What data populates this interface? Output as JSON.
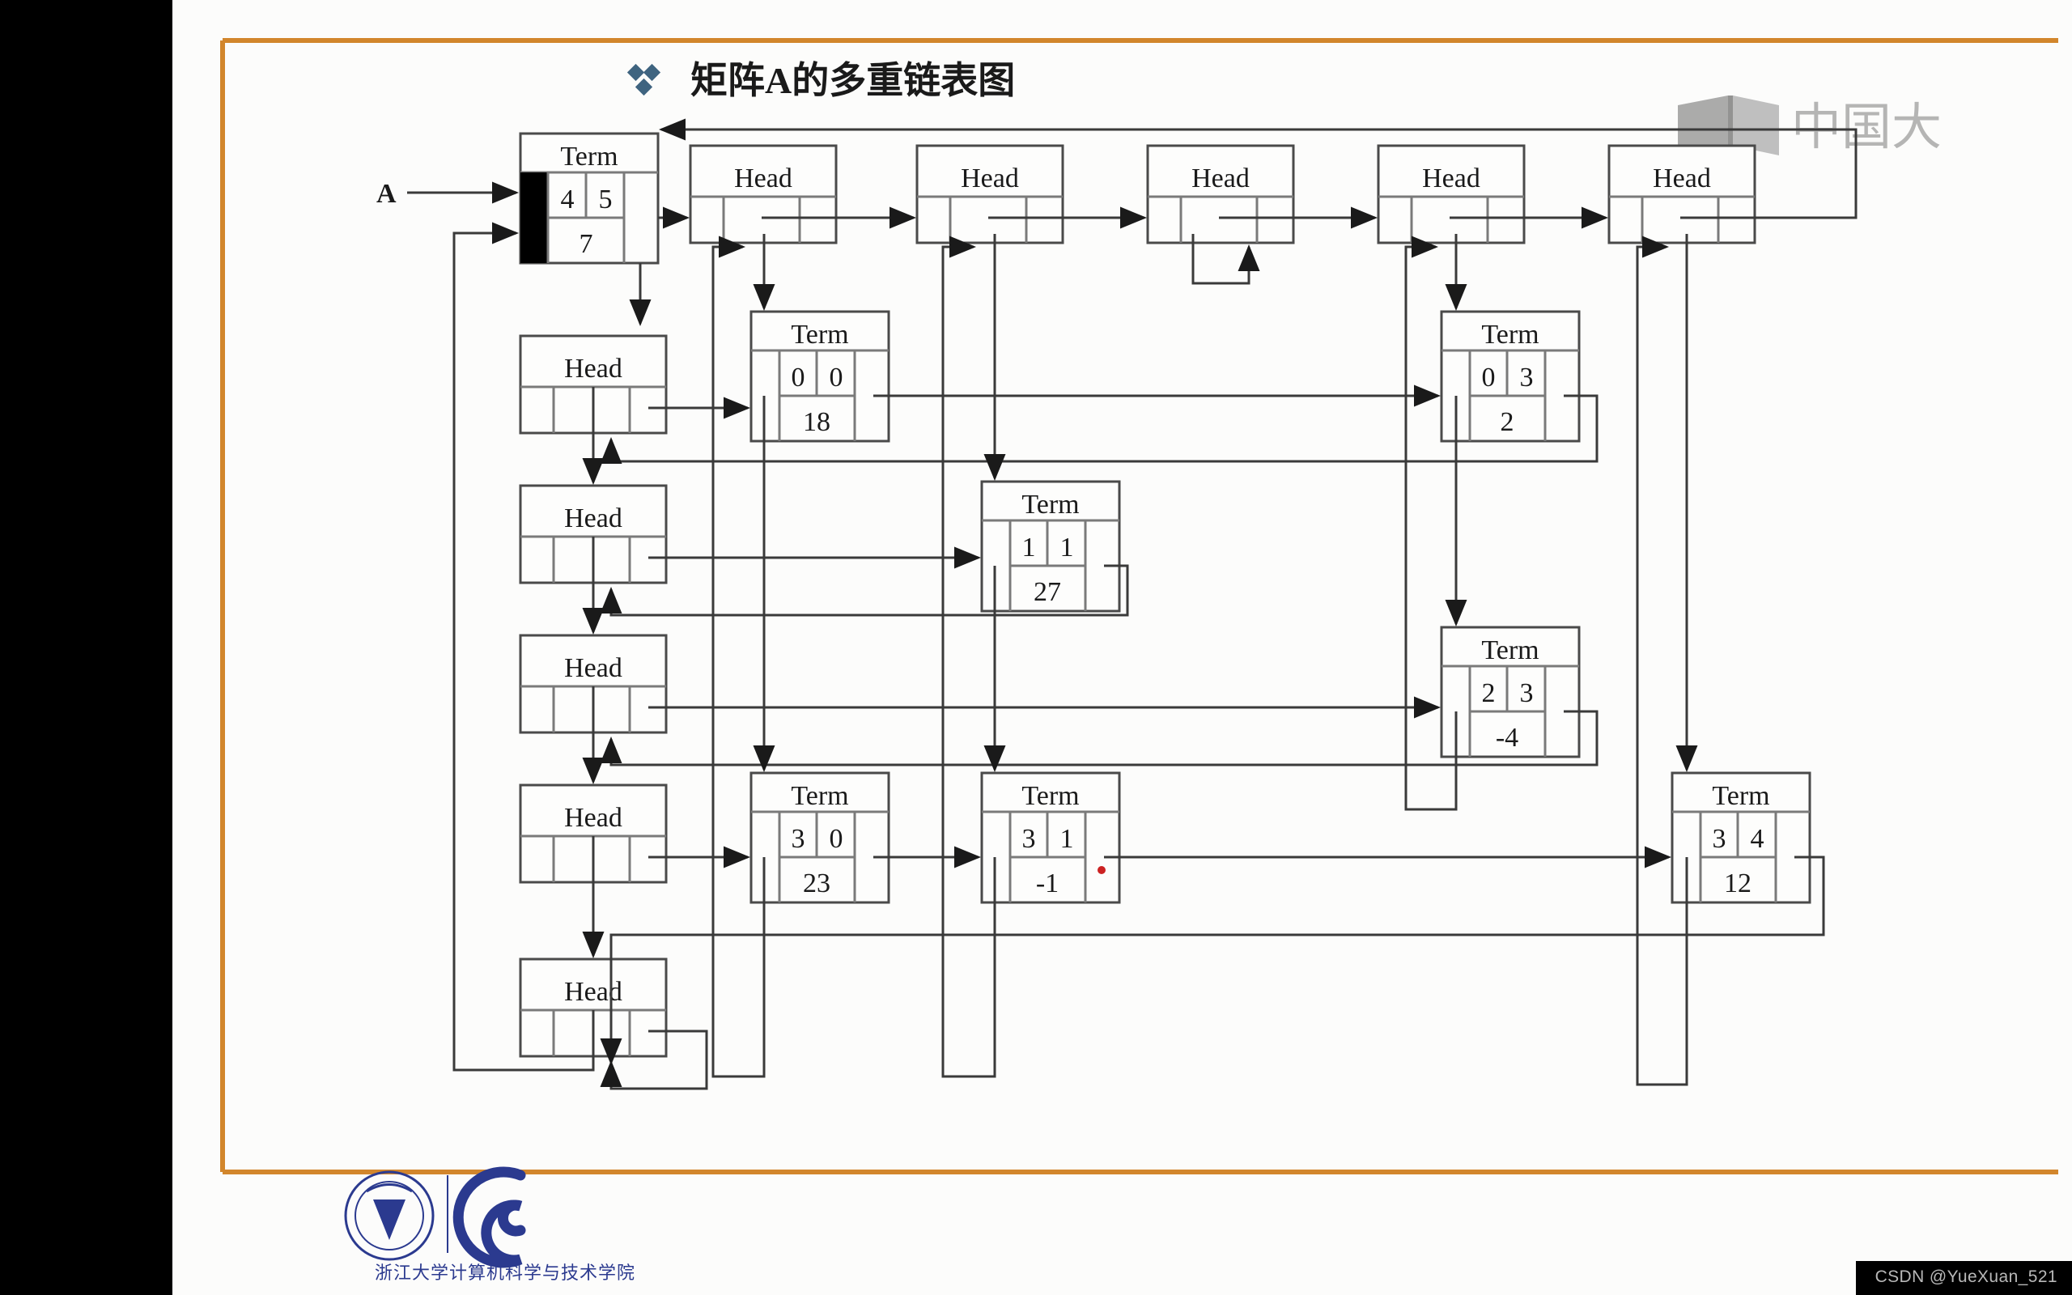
{
  "slide": {
    "title": "矩阵A的多重链表图",
    "bullet_glyph": "❖",
    "bullet_color": "#3f6480",
    "frame_color": "#d2862c",
    "background": "#fcfcfb",
    "entry_label": "A"
  },
  "watermarks": {
    "top_right": {
      "text": "中国大",
      "color": "#9a9a9a",
      "icon": "book-icon"
    },
    "bottom_left": {
      "text": "浙江大学计算机科学与技术学院",
      "color": "#2b3a8f",
      "icon": "zju-seal-icon"
    },
    "bottom_right": {
      "text": "CSDN @YueXuan_521",
      "color": "#b8b8b8",
      "background": "#000000"
    }
  },
  "node_labels": {
    "term": "Term",
    "head": "Head"
  },
  "chart_data": {
    "type": "diagram",
    "title": "矩阵A的多重链表图",
    "description": "Orthogonal (multi-linked) list representation of sparse matrix A",
    "header_node": {
      "kind": "Term",
      "label": "Term",
      "rows": "4",
      "cols": "5",
      "terms": "7",
      "left_column_filled": true
    },
    "matrix": {
      "rows": 4,
      "cols": 5,
      "nonzero_terms": 7
    },
    "column_heads": [
      {
        "id": "ch0",
        "label": "Head",
        "index": 0
      },
      {
        "id": "ch1",
        "label": "Head",
        "index": 1
      },
      {
        "id": "ch2",
        "label": "Head",
        "index": 2
      },
      {
        "id": "ch3",
        "label": "Head",
        "index": 3
      },
      {
        "id": "ch4",
        "label": "Head",
        "index": 4
      }
    ],
    "row_heads": [
      {
        "id": "rh0",
        "label": "Head",
        "index": 0
      },
      {
        "id": "rh1",
        "label": "Head",
        "index": 1
      },
      {
        "id": "rh2",
        "label": "Head",
        "index": 2
      },
      {
        "id": "rh3",
        "label": "Head",
        "index": 3
      },
      {
        "id": "rh4",
        "label": "Head",
        "index": 4
      }
    ],
    "terms": [
      {
        "id": "t00",
        "label": "Term",
        "row": "0",
        "col": "0",
        "value": "18"
      },
      {
        "id": "t03",
        "label": "Term",
        "row": "0",
        "col": "3",
        "value": "2"
      },
      {
        "id": "t11",
        "label": "Term",
        "row": "1",
        "col": "1",
        "value": "27"
      },
      {
        "id": "t23",
        "label": "Term",
        "row": "2",
        "col": "3",
        "value": "-4"
      },
      {
        "id": "t30",
        "label": "Term",
        "row": "3",
        "col": "0",
        "value": "23"
      },
      {
        "id": "t31",
        "label": "Term",
        "row": "3",
        "col": "1",
        "value": "-1"
      },
      {
        "id": "t34",
        "label": "Term",
        "row": "3",
        "col": "4",
        "value": "12"
      }
    ],
    "pointer_marker": {
      "type": "laser-dot",
      "color": "#cc2222",
      "near": "t31"
    }
  }
}
